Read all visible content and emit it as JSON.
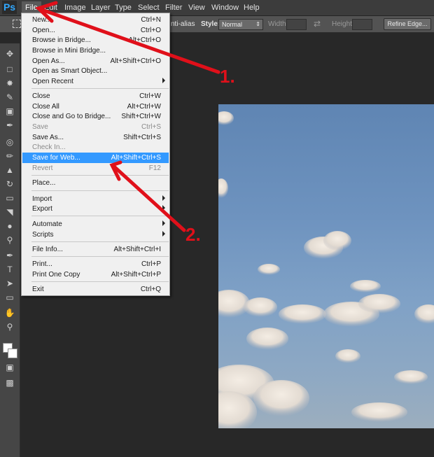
{
  "app": {
    "logo": "Ps"
  },
  "menubar": {
    "items": [
      "File",
      "Edit",
      "Image",
      "Layer",
      "Type",
      "Select",
      "Filter",
      "View",
      "Window",
      "Help"
    ]
  },
  "options": {
    "antialias_label": "nti-alias",
    "style_label": "Style:",
    "style_value": "Normal",
    "width_label": "Width:",
    "height_label": "Height:",
    "refine_edge": "Refine Edge..."
  },
  "file_menu": {
    "items": [
      {
        "label": "New...",
        "shortcut": "Ctrl+N"
      },
      {
        "label": "Open...",
        "shortcut": "Ctrl+O"
      },
      {
        "label": "Browse in Bridge...",
        "shortcut": "Alt+Ctrl+O"
      },
      {
        "label": "Browse in Mini Bridge...",
        "shortcut": ""
      },
      {
        "label": "Open As...",
        "shortcut": "Alt+Shift+Ctrl+O"
      },
      {
        "label": "Open as Smart Object...",
        "shortcut": ""
      },
      {
        "label": "Open Recent",
        "shortcut": ""
      },
      {
        "label": "Close",
        "shortcut": "Ctrl+W"
      },
      {
        "label": "Close All",
        "shortcut": "Alt+Ctrl+W"
      },
      {
        "label": "Close and Go to Bridge...",
        "shortcut": "Shift+Ctrl+W"
      },
      {
        "label": "Save",
        "shortcut": "Ctrl+S"
      },
      {
        "label": "Save As...",
        "shortcut": "Shift+Ctrl+S"
      },
      {
        "label": "Check In...",
        "shortcut": ""
      },
      {
        "label": "Save for Web...",
        "shortcut": "Alt+Shift+Ctrl+S"
      },
      {
        "label": "Revert",
        "shortcut": "F12"
      },
      {
        "label": "Place...",
        "shortcut": ""
      },
      {
        "label": "Import",
        "shortcut": ""
      },
      {
        "label": "Export",
        "shortcut": ""
      },
      {
        "label": "Automate",
        "shortcut": ""
      },
      {
        "label": "Scripts",
        "shortcut": ""
      },
      {
        "label": "File Info...",
        "shortcut": "Alt+Shift+Ctrl+I"
      },
      {
        "label": "Print...",
        "shortcut": "Ctrl+P"
      },
      {
        "label": "Print One Copy",
        "shortcut": "Alt+Shift+Ctrl+P"
      },
      {
        "label": "Exit",
        "shortcut": "Ctrl+Q"
      }
    ]
  },
  "annotations": {
    "step1": "1.",
    "step2": "2.",
    "color": "#e0101a"
  }
}
